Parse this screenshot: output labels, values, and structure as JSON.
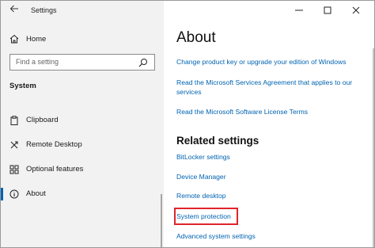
{
  "window": {
    "title": "Settings"
  },
  "sidebar": {
    "home_label": "Home",
    "search_placeholder": "Find a setting",
    "section_label": "System",
    "items": [
      {
        "label": "Clipboard",
        "icon": "clipboard-icon"
      },
      {
        "label": "Remote Desktop",
        "icon": "remote-desktop-icon"
      },
      {
        "label": "Optional features",
        "icon": "optional-features-icon"
      },
      {
        "label": "About",
        "icon": "info-icon",
        "selected": true
      }
    ]
  },
  "main": {
    "title": "About",
    "links": [
      "Change product key or upgrade your edition of Windows",
      "Read the Microsoft Services Agreement that applies to our services",
      "Read the Microsoft Software License Terms"
    ],
    "related_title": "Related settings",
    "related_links": [
      "BitLocker settings",
      "Device Manager",
      "Remote desktop",
      "System protection",
      "Advanced system settings"
    ]
  },
  "colors": {
    "accent": "#0063b1",
    "highlight_border": "#e0252b",
    "sidebar_bg": "#f2f2f2"
  }
}
